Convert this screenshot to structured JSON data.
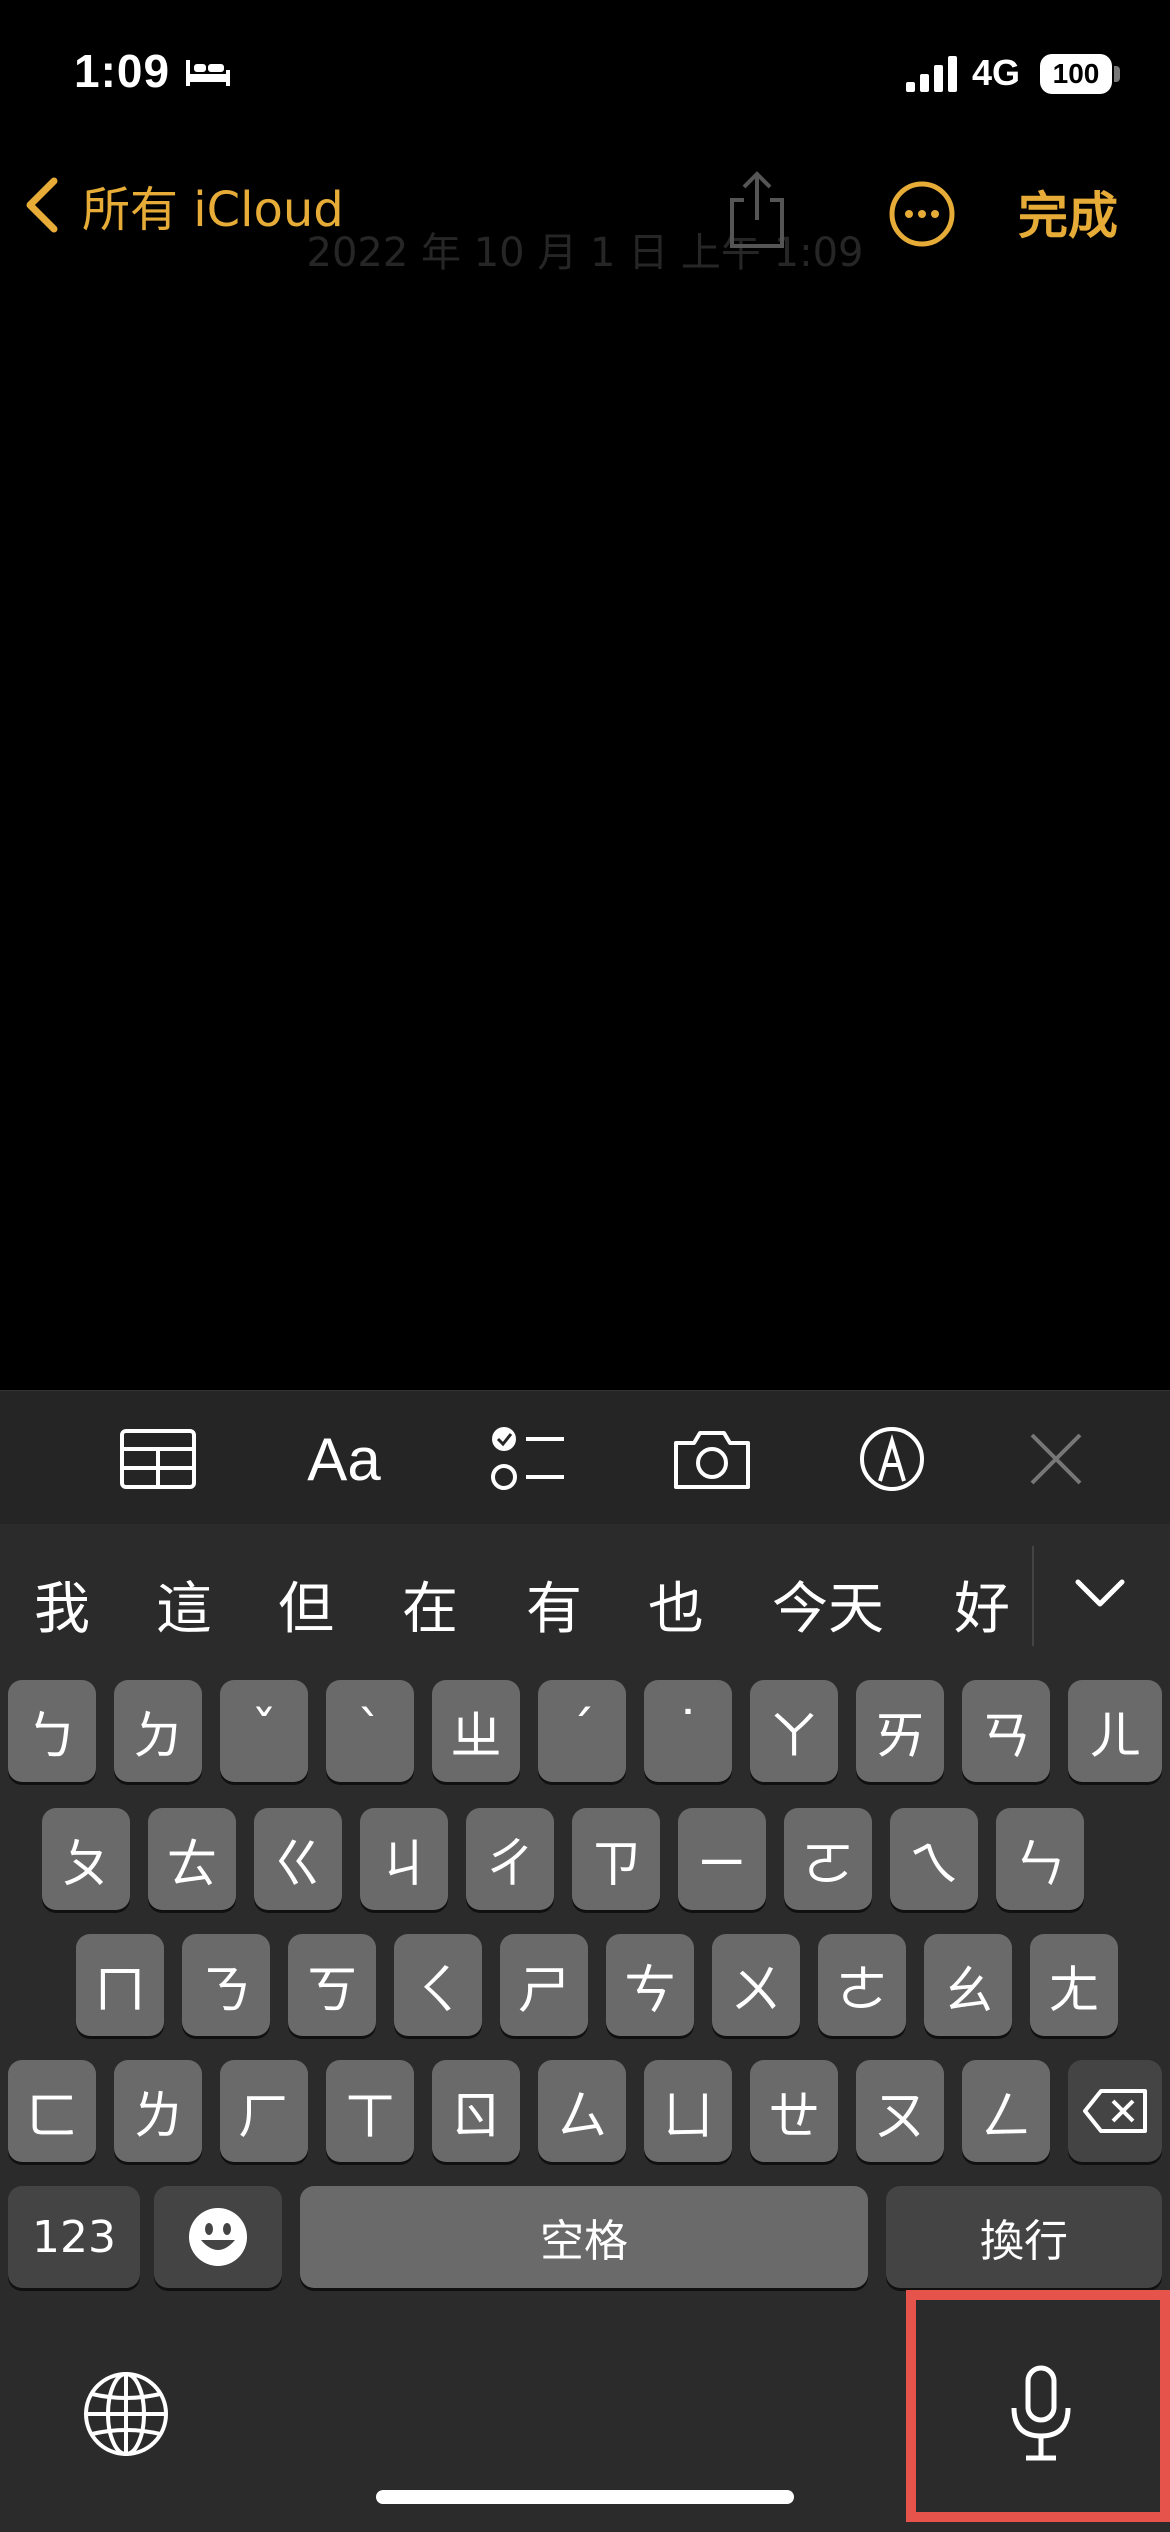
{
  "status_bar": {
    "time": "1:09",
    "network": "4G",
    "battery": "100"
  },
  "nav": {
    "back_label": "所有 iCloud",
    "done_label": "完成",
    "note_date": "2022 年 10 月 1 日 上午 1:09"
  },
  "toolbar": {
    "text_style_label": "Aa"
  },
  "keyboard": {
    "candidates": [
      "我",
      "這",
      "但",
      "在",
      "有",
      "也",
      "今天",
      "好"
    ],
    "row1": [
      "ㄅ",
      "ㄉ",
      "ˇ",
      "ˋ",
      "ㄓ",
      "ˊ",
      "˙",
      "ㄚ",
      "ㄞ",
      "ㄢ",
      "ㄦ"
    ],
    "row2": [
      "ㄆ",
      "ㄊ",
      "ㄍ",
      "ㄐ",
      "ㄔ",
      "ㄗ",
      "ㄧ",
      "ㄛ",
      "ㄟ",
      "ㄣ"
    ],
    "row3": [
      "ㄇ",
      "ㄋ",
      "ㄎ",
      "ㄑ",
      "ㄕ",
      "ㄘ",
      "ㄨ",
      "ㄜ",
      "ㄠ",
      "ㄤ"
    ],
    "row4": [
      "ㄈ",
      "ㄌ",
      "ㄏ",
      "ㄒ",
      "ㄖ",
      "ㄙ",
      "ㄩ",
      "ㄝ",
      "ㄡ",
      "ㄥ"
    ],
    "numbers_label": "123",
    "space_label": "空格",
    "return_label": "換行"
  },
  "colors": {
    "accent": "#E6AC37",
    "highlight_box": "#E5534B"
  }
}
